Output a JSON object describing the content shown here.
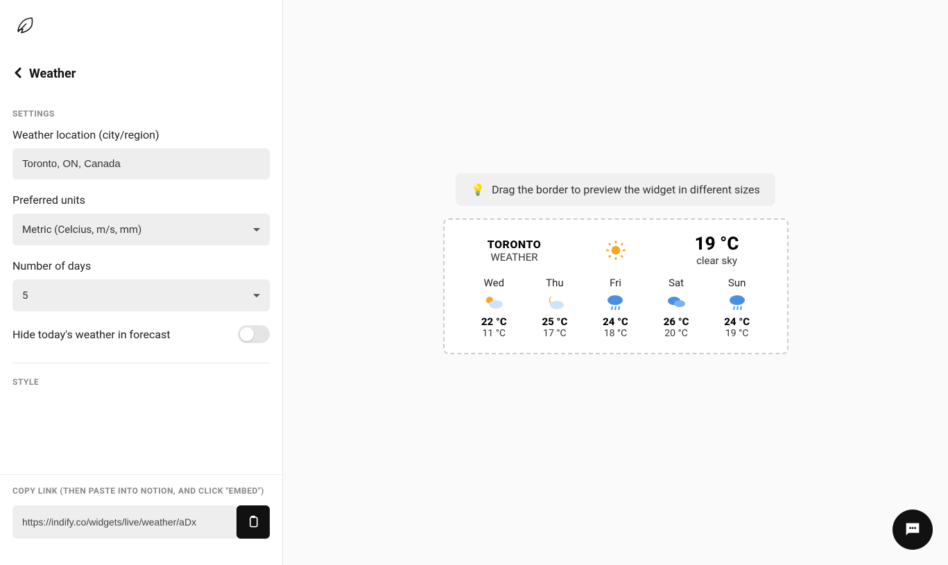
{
  "header": {
    "title": "Weather"
  },
  "sections": {
    "settings_label": "SETTINGS",
    "style_label": "STYLE",
    "copy_label": "COPY LINK (THEN PASTE INTO NOTION, AND CLICK \"EMBED\")"
  },
  "fields": {
    "location_label": "Weather location (city/region)",
    "location_value": "Toronto, ON, Canada",
    "units_label": "Preferred units",
    "units_value": "Metric (Celcius, m/s, mm)",
    "days_label": "Number of days",
    "days_value": "5",
    "hide_today_label": "Hide today's weather in forecast",
    "hide_today_on": false
  },
  "link": {
    "value": "https://indify.co/widgets/live/weather/aDx"
  },
  "hint": {
    "emoji": "💡",
    "text": "Drag the border to preview the widget in different sizes"
  },
  "widget": {
    "city": "TORONTO",
    "subtitle": "WEATHER",
    "current_temp": "19 °C",
    "current_desc": "clear sky",
    "current_icon": "sun",
    "forecast": [
      {
        "day": "Wed",
        "icon": "partly-cloudy-day",
        "high": "22 °C",
        "low": "11 °C"
      },
      {
        "day": "Thu",
        "icon": "partly-cloudy-night",
        "high": "25 °C",
        "low": "17 °C"
      },
      {
        "day": "Fri",
        "icon": "rain",
        "high": "24 °C",
        "low": "18 °C"
      },
      {
        "day": "Sat",
        "icon": "cloudy",
        "high": "26 °C",
        "low": "20 °C"
      },
      {
        "day": "Sun",
        "icon": "rain",
        "high": "24 °C",
        "low": "19 °C"
      }
    ]
  }
}
